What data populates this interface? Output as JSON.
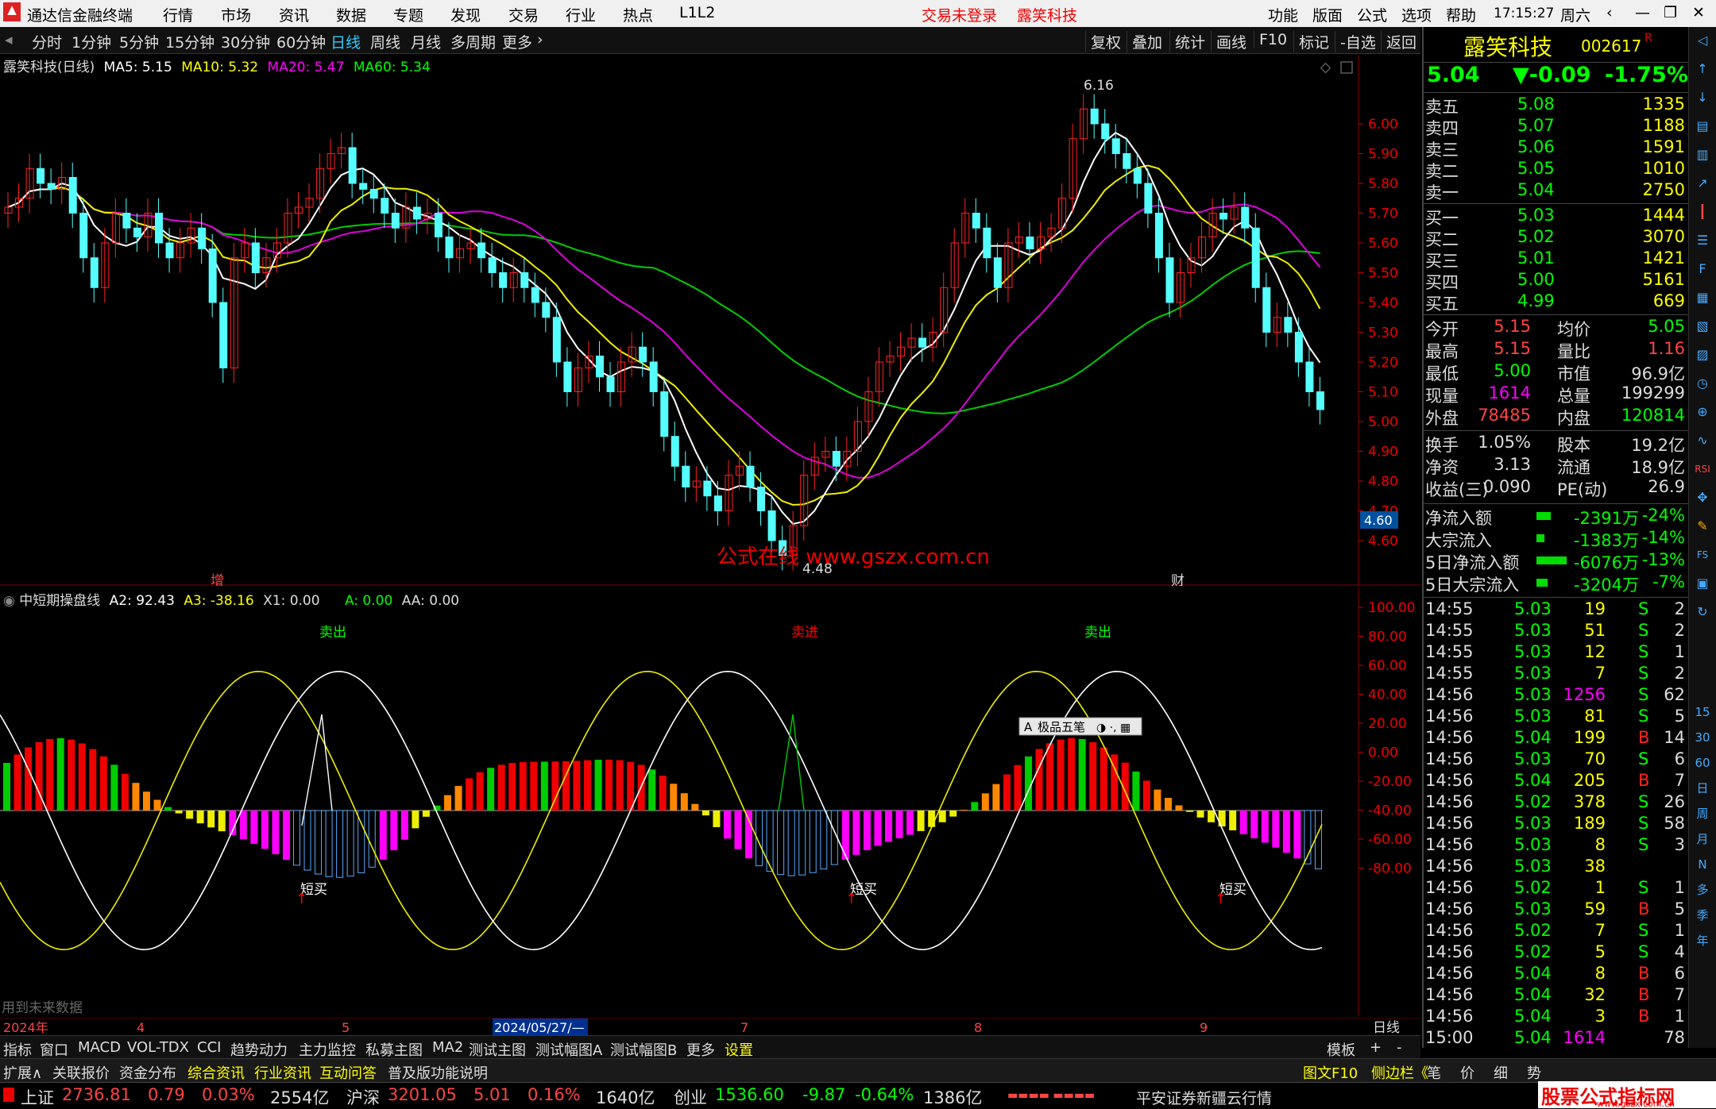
{
  "app": {
    "title": "通达信金融终端",
    "menus": [
      "行情",
      "市场",
      "资讯",
      "数据",
      "专题",
      "发现",
      "交易",
      "行业",
      "热点",
      "L1L2"
    ],
    "login": "交易未登录",
    "stock_title": "露笑科技",
    "right_menus": [
      "功能",
      "版面",
      "公式",
      "选项",
      "帮助"
    ],
    "time": "17:15:27",
    "weekday": "周六"
  },
  "periods": [
    "分时",
    "1分钟",
    "5分钟",
    "15分钟",
    "30分钟",
    "60分钟",
    "日线",
    "周线",
    "月线",
    "多周期",
    "更多"
  ],
  "right_tools": [
    "复权",
    "叠加",
    "统计",
    "画线",
    "F10",
    "标记",
    "-自选",
    "返回"
  ],
  "main_legend": {
    "name": "露笑科技(日线)",
    "ma5": "MA5: 5.15",
    "ma10": "MA10: 5.32",
    "ma20": "MA20: 5.47",
    "ma60": "MA60: 5.34"
  },
  "price_axis": [
    "6.00",
    "5.90",
    "5.80",
    "5.70",
    "5.60",
    "5.50",
    "5.40",
    "5.30",
    "5.20",
    "5.10",
    "5.00",
    "4.90",
    "4.80",
    "4.70",
    "4.60"
  ],
  "price_marker": "4.60",
  "high_label": "6.16",
  "low_label": "4.48",
  "marks": {
    "zeng": "增",
    "cai": "财"
  },
  "watermark": "公式在线  www.gszx.com.cn",
  "sub_legend": {
    "name": "中短期操盘线",
    "a2": "A2: 92.43",
    "a3": "A3: -38.16",
    "x1": "X1: 0.00",
    "a": "A: 0.00",
    "aa": "AA: 0.00"
  },
  "sub_axis": [
    "100.00",
    "80.00",
    "60.00",
    "40.00",
    "20.00",
    "0.00",
    "-20.00",
    "-40.00",
    "-60.00",
    "-80.00"
  ],
  "sub_labels": {
    "sell1": "卖出",
    "sell2": "卖进",
    "sell3": "卖出",
    "buy1": "短买",
    "buy2": "短买",
    "buy3": "短买",
    "future": "用到未来数据"
  },
  "popup": "极品五笔",
  "time_axis": [
    "2024年",
    "4",
    "5",
    "2024/05/27/—",
    "7",
    "8",
    "9",
    "日线"
  ],
  "chart_data": {
    "type": "candlestick",
    "title": "露笑科技(日线)",
    "ylim": [
      4.48,
      6.16
    ],
    "ma": {
      "MA5": 5.15,
      "MA10": 5.32,
      "MA20": 5.47,
      "MA60": 5.34
    },
    "last_close": 5.04,
    "high": 6.16,
    "low": 4.48
  },
  "stock": {
    "name": "露笑科技",
    "code": "002617",
    "flag": "R",
    "price": "5.04",
    "change": "▼-0.09",
    "pct": "-1.75%"
  },
  "asks": [
    {
      "l": "卖五",
      "p": "5.08",
      "v": "1335"
    },
    {
      "l": "卖四",
      "p": "5.07",
      "v": "1188"
    },
    {
      "l": "卖三",
      "p": "5.06",
      "v": "1591"
    },
    {
      "l": "卖二",
      "p": "5.05",
      "v": "1010"
    },
    {
      "l": "卖一",
      "p": "5.04",
      "v": "2750"
    }
  ],
  "bids": [
    {
      "l": "买一",
      "p": "5.03",
      "v": "1444"
    },
    {
      "l": "买二",
      "p": "5.02",
      "v": "3070"
    },
    {
      "l": "买三",
      "p": "5.01",
      "v": "1421"
    },
    {
      "l": "买四",
      "p": "5.00",
      "v": "5161"
    },
    {
      "l": "买五",
      "p": "4.99",
      "v": "669"
    }
  ],
  "stats": [
    {
      "a": "今开",
      "b": "5.15",
      "c": "均价",
      "d": "5.05"
    },
    {
      "a": "最高",
      "b": "5.15",
      "c": "量比",
      "d": "1.16"
    },
    {
      "a": "最低",
      "b": "5.00",
      "c": "市值",
      "d": "96.9亿"
    },
    {
      "a": "现量",
      "b": "1614",
      "c": "总量",
      "d": "199299"
    },
    {
      "a": "外盘",
      "b": "78485",
      "c": "内盘",
      "d": "120814"
    }
  ],
  "stats2": [
    {
      "a": "换手",
      "b": "1.05%",
      "c": "股本",
      "d": "19.2亿"
    },
    {
      "a": "净资",
      "b": "3.13",
      "c": "流通",
      "d": "18.9亿"
    },
    {
      "a": "收益(三)",
      "b": "0.090",
      "c": "PE(动)",
      "d": "26.9"
    }
  ],
  "flows": [
    {
      "a": "净流入额",
      "b": "-2391万",
      "c": "-24%"
    },
    {
      "a": "大宗流入",
      "b": "-1383万",
      "c": "-14%"
    },
    {
      "a": "5日净流入额",
      "b": "-6076万",
      "c": "-13%"
    },
    {
      "a": "5日大宗流入",
      "b": "-3204万",
      "c": "-7%"
    }
  ],
  "ticks": [
    [
      "14:55",
      "5.03",
      "19",
      "S",
      "2"
    ],
    [
      "14:55",
      "5.03",
      "51",
      "S",
      "2"
    ],
    [
      "14:55",
      "5.03",
      "12",
      "S",
      "1"
    ],
    [
      "14:55",
      "5.03",
      "7",
      "S",
      "2"
    ],
    [
      "14:56",
      "5.03",
      "1256",
      "S",
      "62"
    ],
    [
      "14:56",
      "5.03",
      "81",
      "S",
      "5"
    ],
    [
      "14:56",
      "5.04",
      "199",
      "B",
      "14"
    ],
    [
      "14:56",
      "5.03",
      "70",
      "S",
      "6"
    ],
    [
      "14:56",
      "5.04",
      "205",
      "B",
      "7"
    ],
    [
      "14:56",
      "5.02",
      "378",
      "S",
      "26"
    ],
    [
      "14:56",
      "5.03",
      "189",
      "S",
      "58"
    ],
    [
      "14:56",
      "5.03",
      "8",
      "S",
      "3"
    ],
    [
      "14:56",
      "5.03",
      "38",
      "",
      ""
    ],
    [
      "14:56",
      "5.02",
      "1",
      "S",
      "1"
    ],
    [
      "14:56",
      "5.03",
      "59",
      "B",
      "5"
    ],
    [
      "14:56",
      "5.02",
      "7",
      "S",
      "1"
    ],
    [
      "14:56",
      "5.02",
      "5",
      "S",
      "4"
    ],
    [
      "14:56",
      "5.04",
      "8",
      "B",
      "6"
    ],
    [
      "14:56",
      "5.04",
      "32",
      "B",
      "7"
    ],
    [
      "14:56",
      "5.04",
      "3",
      "B",
      "1"
    ],
    [
      "15:00",
      "5.04",
      "1614",
      "",
      "78"
    ]
  ],
  "side_tools": [
    "15",
    "30",
    "60",
    "日",
    "周",
    "月",
    "N",
    "多",
    "季",
    "年"
  ],
  "tabs1": [
    "指标",
    "窗口",
    "MACD",
    "VOL-TDX",
    "CCI",
    "趋势动力",
    "主力监控",
    "私募主图",
    "MA2",
    "测试主图",
    "测试幅图A",
    "测试幅图B",
    "更多",
    "设置"
  ],
  "tabs1_right": [
    "模板",
    "+",
    "-"
  ],
  "tabs2": [
    "扩展∧",
    "关联报价",
    "资金分布",
    "综合资讯",
    "行业资讯",
    "互动问答",
    "普及版功能说明"
  ],
  "tabs2_right": [
    "图文F10",
    "侧边栏《",
    "笔",
    "价",
    "细",
    "势"
  ],
  "status": {
    "sh": "上证",
    "sh_v": "2736.81",
    "sh_c": "0.79",
    "sh_p": "0.03%",
    "sh_a": "2554亿",
    "sz": "沪深",
    "sz_v": "3201.05",
    "sz_c": "5.01",
    "sz_p": "0.16%",
    "sz_a": "1640亿",
    "cy": "创业",
    "cy_v": "1536.60",
    "cy_c": "-9.87",
    "cy_p": "-0.64%",
    "cy_a": "1386亿",
    "broker": "平安证券新疆云行情",
    "logo": "股票公式指标网",
    "logo_url": "www.gszx.com.cn"
  }
}
